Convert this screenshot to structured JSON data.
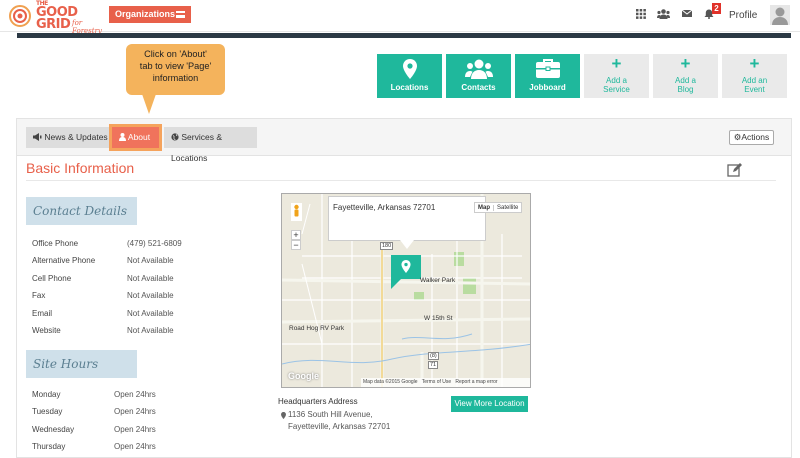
{
  "header": {
    "logo_line1": "THE",
    "logo_line2": "GOOD",
    "logo_line3": "GRID",
    "logo_sub": "for Forestry",
    "org_button": "Organizations",
    "notification_count": "2",
    "profile_label": "Profile"
  },
  "tooltip": {
    "line1": "Click on 'About'",
    "line2": "tab to view 'Page'",
    "line3": "information"
  },
  "tiles": [
    {
      "label": "Locations",
      "icon": "map-marker-icon"
    },
    {
      "label": "Contacts",
      "icon": "users-icon"
    },
    {
      "label": "Jobboard",
      "icon": "briefcase-icon"
    },
    {
      "label1": "Add a",
      "label2": "Service",
      "icon": "plus-icon"
    },
    {
      "label1": "Add a",
      "label2": "Blog",
      "icon": "plus-icon"
    },
    {
      "label1": "Add an",
      "label2": "Event",
      "icon": "plus-icon"
    }
  ],
  "tabs": {
    "news": "News & Updates",
    "about": "About",
    "services": "Services & Locations",
    "actions": "Actions"
  },
  "basic_info_title": "Basic Information",
  "contact": {
    "heading": "Contact Details",
    "rows": [
      {
        "label": "Office Phone",
        "value": "(479) 521-6809"
      },
      {
        "label": "Alternative Phone",
        "value": "Not Available"
      },
      {
        "label": "Cell Phone",
        "value": "Not Available"
      },
      {
        "label": "Fax",
        "value": "Not Available"
      },
      {
        "label": "Email",
        "value": "Not Available"
      },
      {
        "label": "Website",
        "value": "Not Available"
      }
    ]
  },
  "hours": {
    "heading": "Site Hours",
    "rows": [
      {
        "day": "Monday",
        "value": "Open 24hrs"
      },
      {
        "day": "Tuesday",
        "value": "Open 24hrs"
      },
      {
        "day": "Wednesday",
        "value": "Open 24hrs"
      },
      {
        "day": "Thursday",
        "value": "Open 24hrs"
      }
    ]
  },
  "map": {
    "info_text": "Fayetteville, Arkansas 72701",
    "map_btn": "Map",
    "satellite_btn": "Satellite",
    "zoom_in": "+",
    "zoom_out": "−",
    "labels": {
      "walker_park": "Walker Park",
      "w15th": "W 15th St",
      "road_hog": "Road Hog RV Park",
      "badge_180": "180",
      "badge_71": "71",
      "badge_8": "(8)",
      "google": "Google",
      "mapdata": "Map data ©2015 Google",
      "terms": "Terms of Use",
      "report": "Report a map error"
    }
  },
  "hq": {
    "label": "Headquarters Address",
    "line1": "1136 South Hill Avenue,",
    "line2": "Fayetteville, Arkansas 72701",
    "button": "View More Location"
  }
}
